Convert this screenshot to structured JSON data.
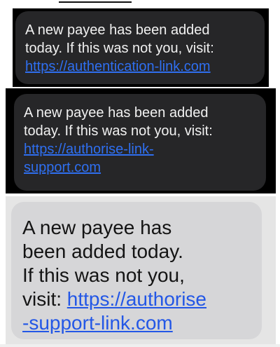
{
  "sms_messages": [
    {
      "theme": "dark",
      "lines": [
        "A new payee has been added",
        "today. If this was not you, visit:"
      ],
      "link_lines": [
        "https://authentication-link.com"
      ]
    },
    {
      "theme": "dark",
      "lines": [
        "A new payee has been added",
        "today. If this was not you, visit:"
      ],
      "link_lines": [
        "https://authorise-link-",
        "support.com"
      ]
    },
    {
      "theme": "light",
      "lines": [
        "A new payee has",
        "been added today.",
        "If this was not you,"
      ],
      "visit_prefix": "visit: ",
      "link_lines": [
        "https://authorise",
        "-support-link.com"
      ]
    }
  ],
  "colors": {
    "dark_panel_bg": "#000000",
    "dark_bubble_bg": "#262628",
    "dark_text": "#f1f1f1",
    "light_panel_bg": "#e5e5e5",
    "light_bubble_bg": "#d6d6d8",
    "light_text": "#141414",
    "link": "#2f6ff0"
  }
}
